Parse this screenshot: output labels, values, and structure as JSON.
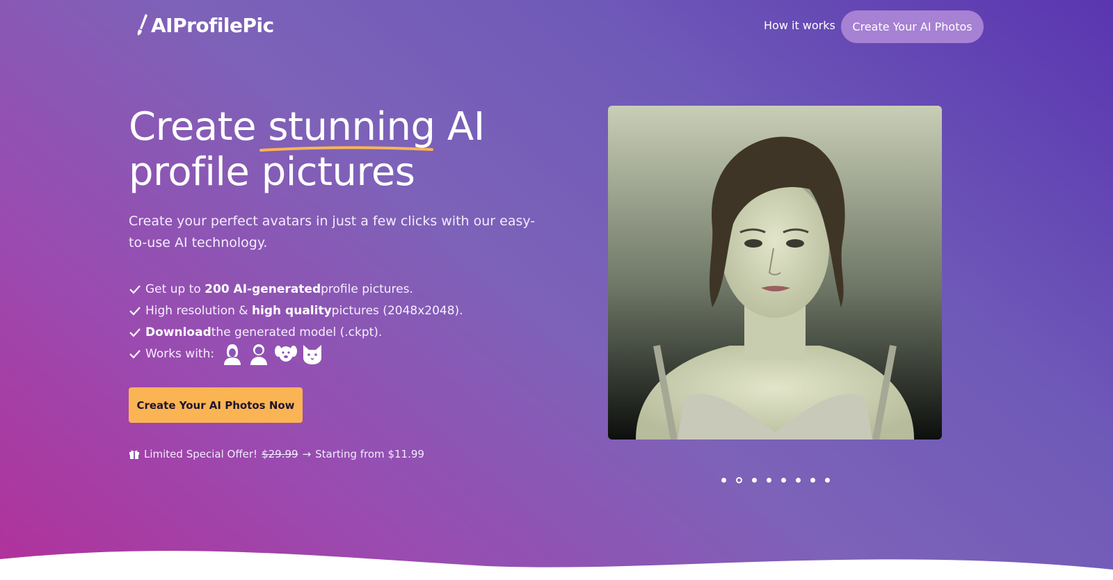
{
  "brand": {
    "name": "AIProfilePic"
  },
  "nav": {
    "how_it_works": "How it works",
    "cta": "Create Your AI Photos"
  },
  "hero": {
    "headline_before": "Create ",
    "headline_highlight": "stunning",
    "headline_after": " AI",
    "headline_line2": "profile pictures",
    "subhead": "Create your perfect avatars in just a few clicks with our easy-to-use AI technology.",
    "features": [
      {
        "pre": "Get up to ",
        "bold": "200 AI-generated",
        "post": " profile pictures."
      },
      {
        "pre": "High resolution & ",
        "bold": "high quality",
        "post": " pictures (2048x2048)."
      },
      {
        "pre": "",
        "bold": "Download",
        "post": " the generated model (.ckpt)."
      }
    ],
    "works_with_label": "Works with:",
    "works_with_icons": [
      "woman-icon",
      "man-icon",
      "dog-icon",
      "cat-icon"
    ],
    "cta": "Create Your AI Photos Now",
    "offer": {
      "label": "Limited Special Offer!",
      "old_price": "$29.99",
      "arrow": "→",
      "new_price": "Starting from $11.99"
    }
  },
  "carousel": {
    "slide_count": 8,
    "active_index": 1
  },
  "colors": {
    "accent": "#fbb454",
    "nav_button": "#a781d3",
    "gradient_start": "#b1319a",
    "gradient_end": "#5a35b0"
  }
}
